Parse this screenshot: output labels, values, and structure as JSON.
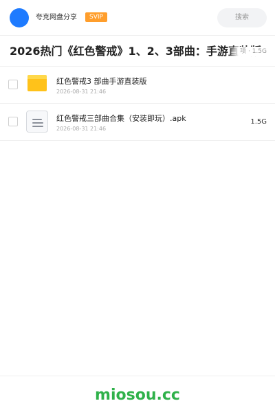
{
  "header": {
    "username": "夸克网盘分享",
    "vip_badge": "SVIP",
    "search_label": "搜索"
  },
  "share": {
    "title": "2026热门《红色警戒》1、2、3部曲：手游直装版",
    "meta": "项 · 1.5G"
  },
  "files": [
    {
      "name": "红色警戒3 部曲手游直装版",
      "date": "2026-08-31 21:46",
      "size": "",
      "icon": "folder-icon"
    },
    {
      "name": "红色警戒三部曲合集（安装即玩）.apk",
      "date": "2026-08-31 21:46",
      "size": "1.5G",
      "icon": "document-icon"
    }
  ],
  "footer": {
    "watermark": "miosou.cc"
  },
  "colors": {
    "accent": "#1e7bff",
    "vip": "#ff9e2c",
    "folder": "#ffc21a",
    "watermark": "#2fb14a"
  }
}
